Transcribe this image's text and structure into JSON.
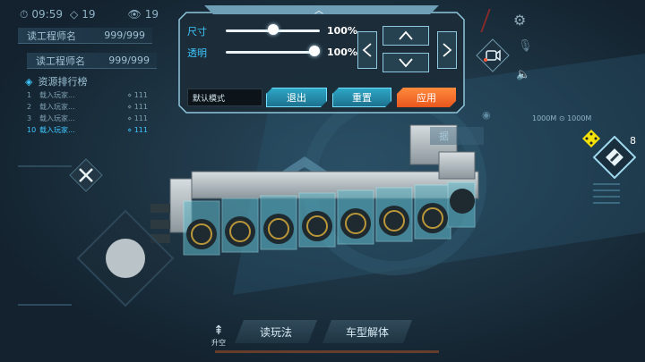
{
  "status": {
    "time": "09:59",
    "count": "19",
    "views": "19"
  },
  "engineers": [
    {
      "name": "读工程师名",
      "score": "999/999"
    },
    {
      "name": "读工程师名",
      "score": "999/999"
    }
  ],
  "ranking": {
    "title": "资源排行榜",
    "rows": [
      {
        "no": "1",
        "name": "载入玩家...",
        "score": "111"
      },
      {
        "no": "2",
        "name": "载入玩家...",
        "score": "111"
      },
      {
        "no": "3",
        "name": "载入玩家...",
        "score": "111"
      },
      {
        "no": "10",
        "name": "载入玩家...",
        "score": "111"
      }
    ]
  },
  "panel": {
    "size_label": "尺寸",
    "size_value": "100%",
    "size_level": 0.5,
    "alpha_label": "透明",
    "alpha_value": "100%",
    "alpha_level": 1.0,
    "mode_value": "默认模式",
    "exit_label": "退出",
    "reset_label": "重置",
    "apply_label": "应用"
  },
  "right": {
    "distance": "1000M",
    "distance2": "1000M",
    "badge_count": "8",
    "label_partial": "据"
  },
  "bottom": {
    "play_label": "读玩法",
    "disassemble_label": "车型解体",
    "lift_label": "升空"
  },
  "colors": {
    "accent": "#3ec8ff",
    "orange": "#ff6a1f",
    "yellow": "#f5e10a"
  }
}
